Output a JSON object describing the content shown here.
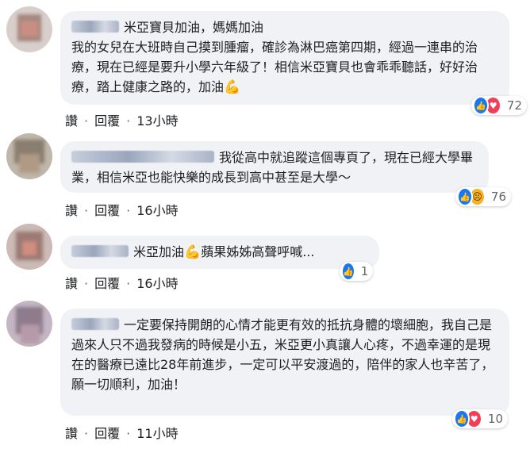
{
  "comments": [
    {
      "author": "",
      "text": "米亞寶貝加油，媽媽加油\n我的女兒在大班時自己摸到腫瘤，確診為淋巴癌第四期，經過一連串的治療，現在已經是要升小學六年級了！相信米亞寶貝也會乖乖聽話，好好治療，踏上健康之路的，加油",
      "emoji": "💪",
      "reactions": [
        "like-icon",
        "love-icon"
      ],
      "reaction_count": "72",
      "like_label": "讚",
      "reply_label": "回覆",
      "time": "13小時"
    },
    {
      "author": "",
      "text": "我從高中就追蹤這個專頁了，現在已經大學畢業，相信米亞也能快樂的成長到高中甚至是大學～",
      "emoji": "",
      "reactions": [
        "like-icon",
        "sad-icon"
      ],
      "reaction_count": "76",
      "like_label": "讚",
      "reply_label": "回覆",
      "time": "16小時"
    },
    {
      "author": "",
      "text_before": "米亞加油",
      "emoji": "💪",
      "text_after": "蘋果姊姊高聲呼喊...",
      "reactions": [
        "like-icon"
      ],
      "reaction_count": "1",
      "like_label": "讚",
      "reply_label": "回覆",
      "time": "16小時"
    },
    {
      "author": "",
      "text": "一定要保持開朗的心情才能更有效的抵抗身體的壞細胞，我自己是過來人只不過我發病的時候是小五，米亞更小真讓人心疼，不過幸運的是現在的醫療已遠比28年前進步，一定可以平安渡過的，陪伴的家人也辛苦了，願一切順利，加油！",
      "emoji": "",
      "reactions": [
        "like-icon",
        "love-icon"
      ],
      "reaction_count": "10",
      "like_label": "讚",
      "reply_label": "回覆",
      "time": "11小時"
    }
  ],
  "separator": "·",
  "colors": {
    "bubble": "#f0f2f5",
    "like": "#1877f2",
    "love": "#f33e58",
    "sad": "#f7b125",
    "muted": "#65676b"
  }
}
